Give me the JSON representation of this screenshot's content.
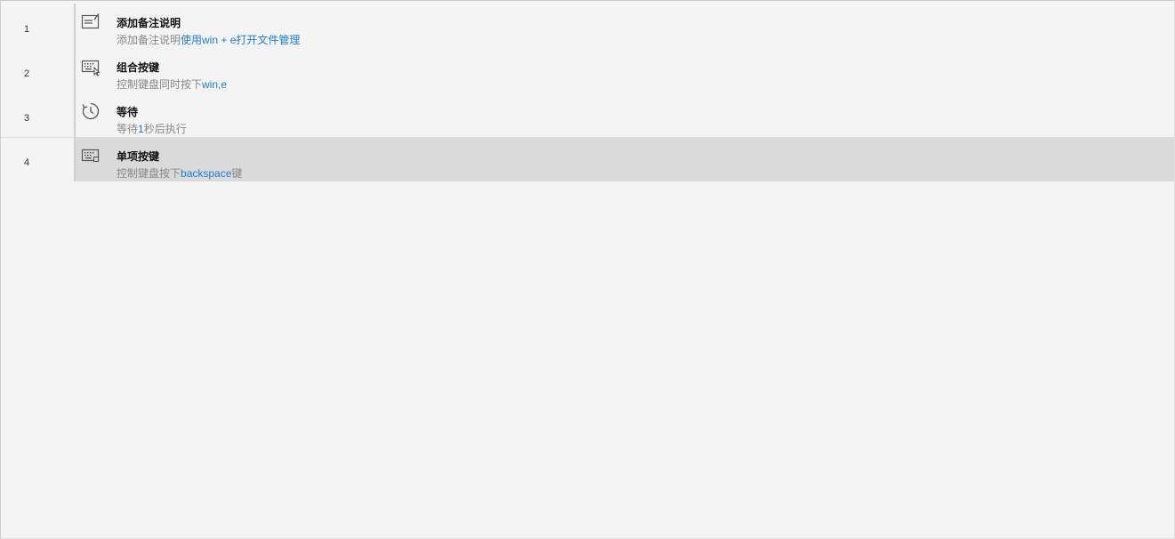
{
  "steps": [
    {
      "number": "1",
      "icon": "note-edit-icon",
      "title": "添加备注说明",
      "desc_prefix": "添加备注说明",
      "desc_highlight": "使用win + e打开文件管理",
      "desc_suffix": ""
    },
    {
      "number": "2",
      "icon": "keyboard-combo-icon",
      "title": "组合按键",
      "desc_prefix": "控制键盘同时按下",
      "desc_highlight": "win,e",
      "desc_suffix": ""
    },
    {
      "number": "3",
      "icon": "wait-clock-icon",
      "title": "等待",
      "desc_prefix": "等待",
      "desc_highlight": "1",
      "desc_suffix": "秒后执行"
    },
    {
      "number": "4",
      "icon": "keyboard-single-key-icon",
      "title": "单项按键",
      "desc_prefix": "控制键盘按下",
      "desc_highlight": "backspace",
      "desc_suffix": "键"
    }
  ],
  "selected_step": "4",
  "colors": {
    "background": "#f4f4f4",
    "selected_row": "#dadada",
    "highlight_text": "#1e7bd9",
    "muted_text": "#888888"
  }
}
